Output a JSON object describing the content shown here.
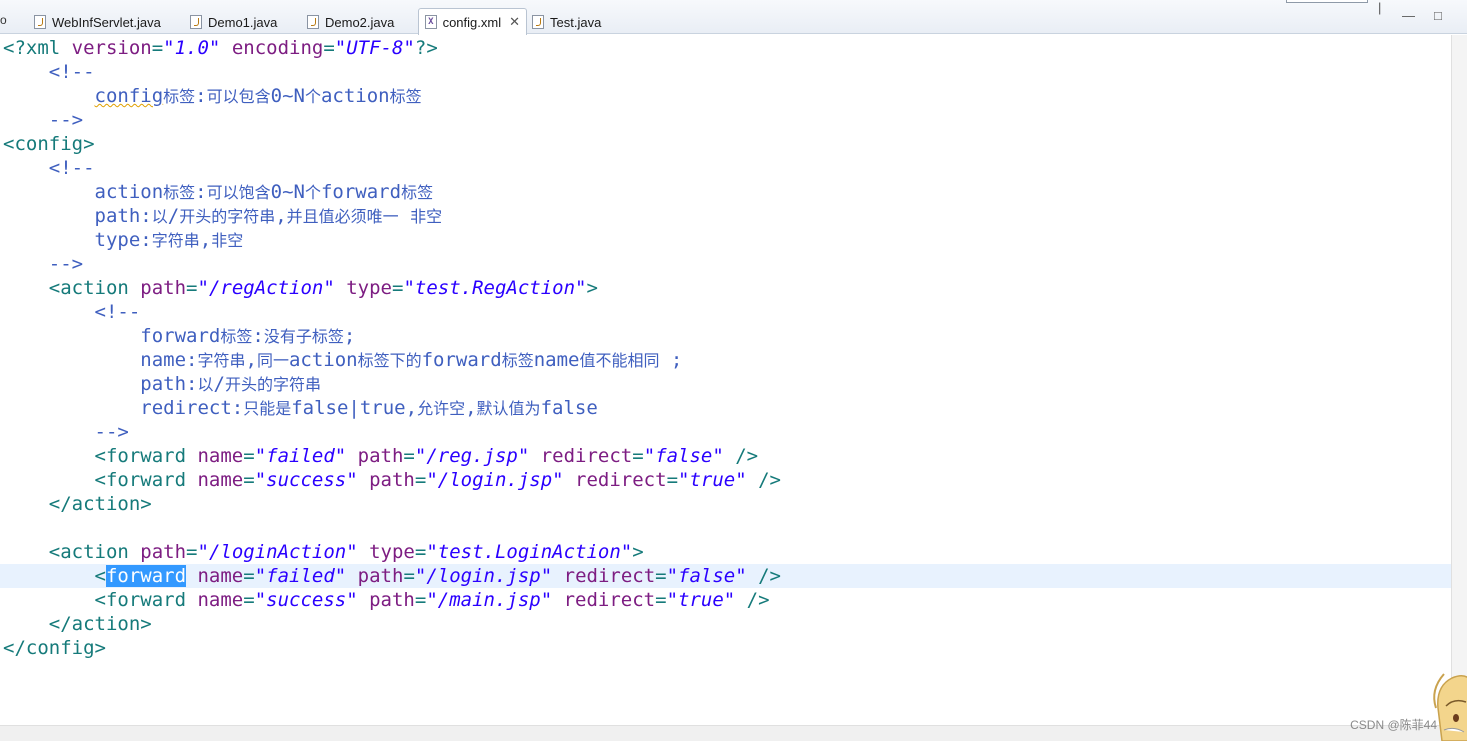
{
  "tabs": [
    {
      "label": "WebInfServlet.java",
      "type": "java"
    },
    {
      "label": "Demo1.java",
      "type": "java"
    },
    {
      "label": "Demo2.java",
      "type": "java"
    },
    {
      "label": "config.xml",
      "type": "xml",
      "active": true
    },
    {
      "label": "Test.java",
      "type": "java"
    }
  ],
  "tab_edge_fragment": "o",
  "close_glyph": "✕",
  "xml_icon_glyph": "X",
  "window_controls": {
    "minimize": "—",
    "maximize": "□",
    "left_fragment": "|"
  },
  "colors": {
    "tag": "#157a7a",
    "attribute": "#7d1d82",
    "string": "#2a00ff",
    "comment": "#3f5fbf",
    "selection": "#3399ff",
    "current_line": "#e8f2fe"
  },
  "editor": {
    "current_line_index": 22,
    "lines": [
      [
        [
          "pi",
          "<?xml "
        ],
        [
          "attr",
          "version"
        ],
        [
          "pi",
          "="
        ],
        [
          "str",
          "\"1.0\""
        ],
        [
          "pi",
          " "
        ],
        [
          "attr",
          "encoding"
        ],
        [
          "pi",
          "="
        ],
        [
          "str",
          "\"UTF-8\""
        ],
        [
          "pi",
          "?>"
        ]
      ],
      [
        [
          "cmt",
          "    <!--"
        ]
      ],
      [
        [
          "cmt",
          "        "
        ],
        [
          "squig",
          "config"
        ],
        [
          "cmt",
          "标签:可以包含0~N个action标签"
        ]
      ],
      [
        [
          "cmt",
          "    -->"
        ]
      ],
      [
        [
          "tag",
          "<config>"
        ]
      ],
      [
        [
          "cmt",
          "    <!--"
        ]
      ],
      [
        [
          "cmt",
          "        action标签:可以饱含0~N个forward标签"
        ]
      ],
      [
        [
          "cmt",
          "        path:以/开头的字符串,并且值必须唯一 非空"
        ]
      ],
      [
        [
          "cmt",
          "        type:字符串,非空"
        ]
      ],
      [
        [
          "cmt",
          "    -->"
        ]
      ],
      [
        [
          "tag",
          "    <action "
        ],
        [
          "attr",
          "path"
        ],
        [
          "tag",
          "="
        ],
        [
          "str",
          "\"/regAction\""
        ],
        [
          "tag",
          " "
        ],
        [
          "attr",
          "type"
        ],
        [
          "tag",
          "="
        ],
        [
          "str",
          "\"test.RegAction\""
        ],
        [
          "tag",
          ">"
        ]
      ],
      [
        [
          "cmt",
          "        <!--"
        ]
      ],
      [
        [
          "cmt",
          "            forward标签:没有子标签;"
        ]
      ],
      [
        [
          "cmt",
          "            name:字符串,同一action标签下的forward标签name值不能相同 ;"
        ]
      ],
      [
        [
          "cmt",
          "            path:以/开头的字符串"
        ]
      ],
      [
        [
          "cmt",
          "            redirect:只能是false|true,允许空,默认值为false"
        ]
      ],
      [
        [
          "cmt",
          "        -->"
        ]
      ],
      [
        [
          "tag",
          "        <forward "
        ],
        [
          "attr",
          "name"
        ],
        [
          "tag",
          "="
        ],
        [
          "str",
          "\"failed\""
        ],
        [
          "tag",
          " "
        ],
        [
          "attr",
          "path"
        ],
        [
          "tag",
          "="
        ],
        [
          "str",
          "\"/reg.jsp\""
        ],
        [
          "tag",
          " "
        ],
        [
          "attr",
          "redirect"
        ],
        [
          "tag",
          "="
        ],
        [
          "str",
          "\"false\""
        ],
        [
          "tag",
          " />"
        ]
      ],
      [
        [
          "tag",
          "        <forward "
        ],
        [
          "attr",
          "name"
        ],
        [
          "tag",
          "="
        ],
        [
          "str",
          "\"success\""
        ],
        [
          "tag",
          " "
        ],
        [
          "attr",
          "path"
        ],
        [
          "tag",
          "="
        ],
        [
          "str",
          "\"/login.jsp\""
        ],
        [
          "tag",
          " "
        ],
        [
          "attr",
          "redirect"
        ],
        [
          "tag",
          "="
        ],
        [
          "str",
          "\"true\""
        ],
        [
          "tag",
          " />"
        ]
      ],
      [
        [
          "tag",
          "    </action>"
        ]
      ],
      [],
      [
        [
          "tag",
          "    <action "
        ],
        [
          "attr",
          "path"
        ],
        [
          "tag",
          "="
        ],
        [
          "str",
          "\"/loginAction\""
        ],
        [
          "tag",
          " "
        ],
        [
          "attr",
          "type"
        ],
        [
          "tag",
          "="
        ],
        [
          "str",
          "\"test.LoginAction\""
        ],
        [
          "tag",
          ">"
        ]
      ],
      [
        [
          "tag",
          "        <"
        ],
        [
          "sel",
          "forward"
        ],
        [
          "tag",
          " "
        ],
        [
          "attr",
          "name"
        ],
        [
          "tag",
          "="
        ],
        [
          "str",
          "\"failed\""
        ],
        [
          "tag",
          " "
        ],
        [
          "attr",
          "path"
        ],
        [
          "tag",
          "="
        ],
        [
          "str",
          "\"/login.jsp\""
        ],
        [
          "tag",
          " "
        ],
        [
          "attr",
          "redirect"
        ],
        [
          "tag",
          "="
        ],
        [
          "str",
          "\"false\""
        ],
        [
          "tag",
          " />"
        ]
      ],
      [
        [
          "tag",
          "        <forward "
        ],
        [
          "attr",
          "name"
        ],
        [
          "tag",
          "="
        ],
        [
          "str",
          "\"success\""
        ],
        [
          "tag",
          " "
        ],
        [
          "attr",
          "path"
        ],
        [
          "tag",
          "="
        ],
        [
          "str",
          "\"/main.jsp\""
        ],
        [
          "tag",
          " "
        ],
        [
          "attr",
          "redirect"
        ],
        [
          "tag",
          "="
        ],
        [
          "str",
          "\"true\""
        ],
        [
          "tag",
          " />"
        ]
      ],
      [
        [
          "tag",
          "    </action>"
        ]
      ],
      [
        [
          "tag",
          "</config>"
        ]
      ]
    ]
  },
  "watermark": "CSDN @陈菲44"
}
